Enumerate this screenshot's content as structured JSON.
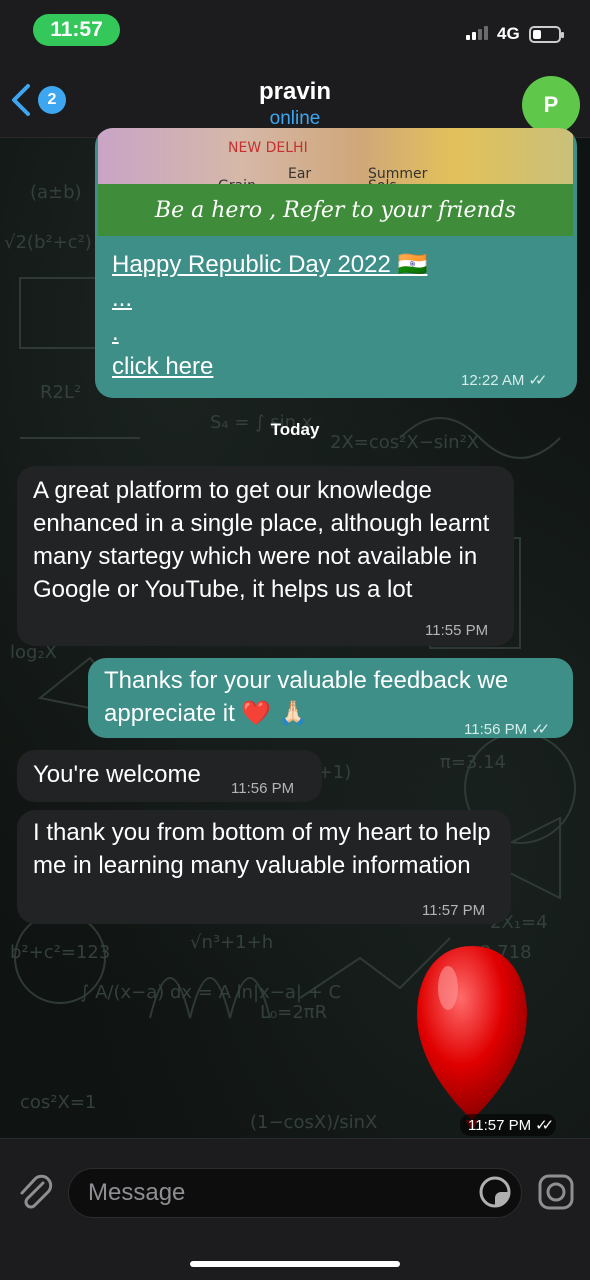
{
  "status_bar": {
    "time": "11:57",
    "network": "4G"
  },
  "header": {
    "back_badge": "2",
    "contact_name": "pravin",
    "contact_status": "online",
    "avatar_letter": "P"
  },
  "preview_message": {
    "image_banner_text": "Be a hero , Refer to your friends",
    "map_labels": [
      "NEW DELHI",
      "Ear",
      "Grain",
      "Summer",
      "Sols"
    ],
    "link_lines": [
      "Happy Republic Day 2022 🇮🇳",
      "...",
      ".",
      "click here"
    ],
    "time": "12:22 AM"
  },
  "date_separator": "Today",
  "messages": [
    {
      "direction": "incoming",
      "text": "A great platform to get our knowledge enhanced in a single place, although learnt many startegy which were not available in Google or YouTube, it helps us a lot",
      "time": "11:55 PM"
    },
    {
      "direction": "outgoing",
      "text": "Thanks for your valuable feedback we appreciate it ❤️ 🙏🏻",
      "time": "11:56 PM"
    },
    {
      "direction": "incoming",
      "text": "You're welcome",
      "time": "11:56 PM"
    },
    {
      "direction": "incoming",
      "text": "I thank you from bottom of my heart to help me in learning many valuable information",
      "time": "11:57 PM"
    },
    {
      "direction": "outgoing",
      "type": "sticker-balloon",
      "time": "11:57 PM"
    }
  ],
  "composer": {
    "placeholder": "Message"
  },
  "colors": {
    "accent_blue": "#3ea6f0",
    "status_green": "#34c759",
    "outgoing_bubble": "#3d8f88",
    "incoming_bubble": "#212325"
  }
}
